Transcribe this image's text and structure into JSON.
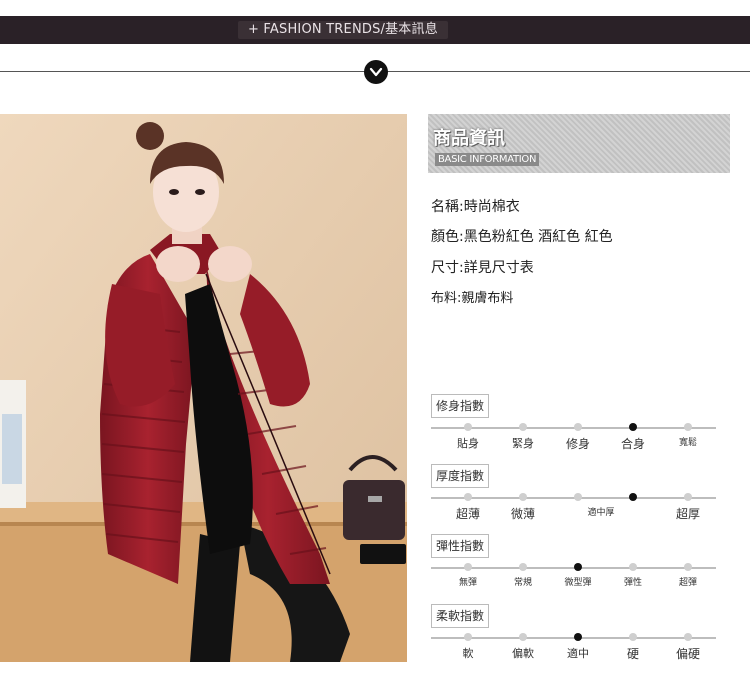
{
  "header": {
    "title": "+ FASHION TRENDS/基本訊息"
  },
  "info_banner": {
    "title": "商品資訊",
    "subtitle": "BASIC INFORMATION"
  },
  "specs": [
    {
      "text": "名稱:時尚棉衣"
    },
    {
      "text": "顏色:黑色粉紅色 酒紅色 紅色"
    },
    {
      "text": "尺寸:詳見尺寸表"
    },
    {
      "text": "布料:親膚布料"
    }
  ],
  "indices": [
    {
      "label": "修身指數",
      "options": [
        "貼身",
        "緊身",
        "修身",
        "合身",
        "寬鬆"
      ],
      "selected": 3
    },
    {
      "label": "厚度指數",
      "options": [
        "超薄",
        "微薄",
        "適中厚",
        "",
        "超厚"
      ],
      "selected": 3
    },
    {
      "label": "彈性指數",
      "options": [
        "無彈",
        "常規",
        "微型彈",
        "彈性",
        "超彈"
      ],
      "selected": 2
    },
    {
      "label": "柔軟指數",
      "options": [
        "軟",
        "偏軟",
        "適中",
        "硬",
        "偏硬"
      ],
      "selected": 2
    }
  ],
  "colors": {
    "topbar": "#2a2127",
    "coat": "#8e1a26",
    "wall": "#e7cfb3",
    "active_dot": "#111111"
  },
  "icons": {
    "divider": "chevron-down-icon"
  }
}
